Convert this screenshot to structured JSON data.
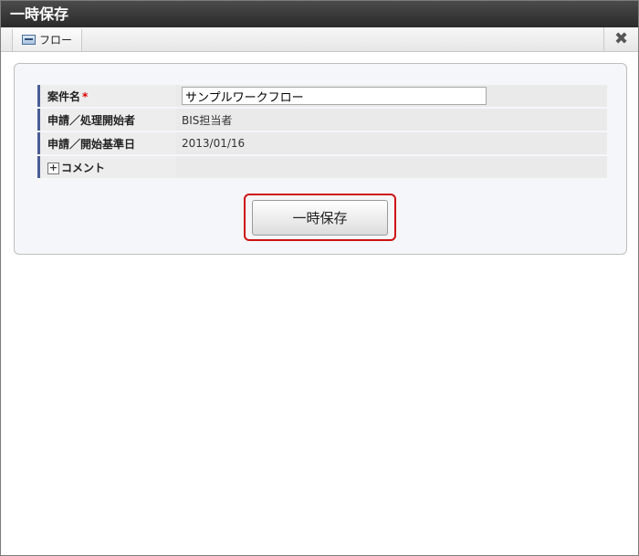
{
  "window": {
    "title": "一時保存"
  },
  "toolbar": {
    "flow_tab_label": "フロー",
    "close_label": "✖"
  },
  "form": {
    "rows": [
      {
        "label": "案件名",
        "required_mark": "*",
        "value": "サンプルワークフロー"
      },
      {
        "label": "申請／処理開始者",
        "value": "BIS担当者"
      },
      {
        "label": "申請／開始基準日",
        "value": "2013/01/16"
      },
      {
        "label": "コメント",
        "toggle": "+"
      }
    ]
  },
  "actions": {
    "save_label": "一時保存"
  },
  "colors": {
    "title_bar": "#333333",
    "label_accent": "#4a5d96",
    "highlight": "#cc1111"
  }
}
